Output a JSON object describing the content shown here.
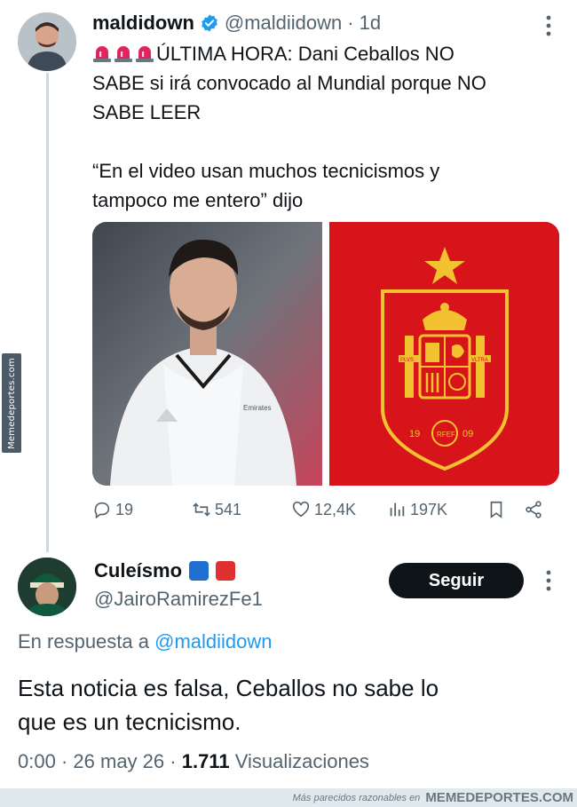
{
  "watermark_side": "Memedeportes.com",
  "tweet": {
    "name": "maldidown",
    "handle": "@maldiidown",
    "separator": "·",
    "time": "1d",
    "line1": "ÚLTIMA HORA: Dani Ceballos NO",
    "line2": "SABE si irá convocado al Mundial porque NO",
    "line3": "SABE LEER",
    "quote1": "“En el video usan muchos tecnicismos y",
    "quote2": "tampoco me entero” dijo",
    "stats": {
      "replies": "19",
      "retweets": "541",
      "likes": "12,4K",
      "views": "197K"
    },
    "shield_text": {
      "left_ribbon": "PLVS",
      "right_ribbon": "VLTRA",
      "monogram": "RFEF",
      "year_left": "19",
      "year_right": "09"
    },
    "jacket_text": "Emirates"
  },
  "reply": {
    "name": "Culeísmo",
    "handle": "@JairoRamirezFe1",
    "follow_label": "Seguir",
    "reply_prefix": "En respuesta a",
    "reply_mention": "@maldiidown",
    "text_line1": "Esta noticia es falsa, Ceballos no sabe lo",
    "text_line2": "que es un tecnicismo.",
    "time": "0:00",
    "date": "26 may 26",
    "views_count": "1.711",
    "views_label": "Visualizaciones"
  },
  "footer": {
    "small": "Más parecidos razonables en",
    "brand": "MEMEDEPORTES.COM"
  },
  "colors": {
    "blue_verified": "#1d9bf0",
    "spain_red": "#d8141b",
    "spain_gold": "#f2c230"
  },
  "icons": [
    "verified-icon",
    "siren-icon",
    "reply-icon",
    "retweet-icon",
    "like-icon",
    "views-icon",
    "bookmark-icon",
    "share-icon",
    "more-icon"
  ]
}
